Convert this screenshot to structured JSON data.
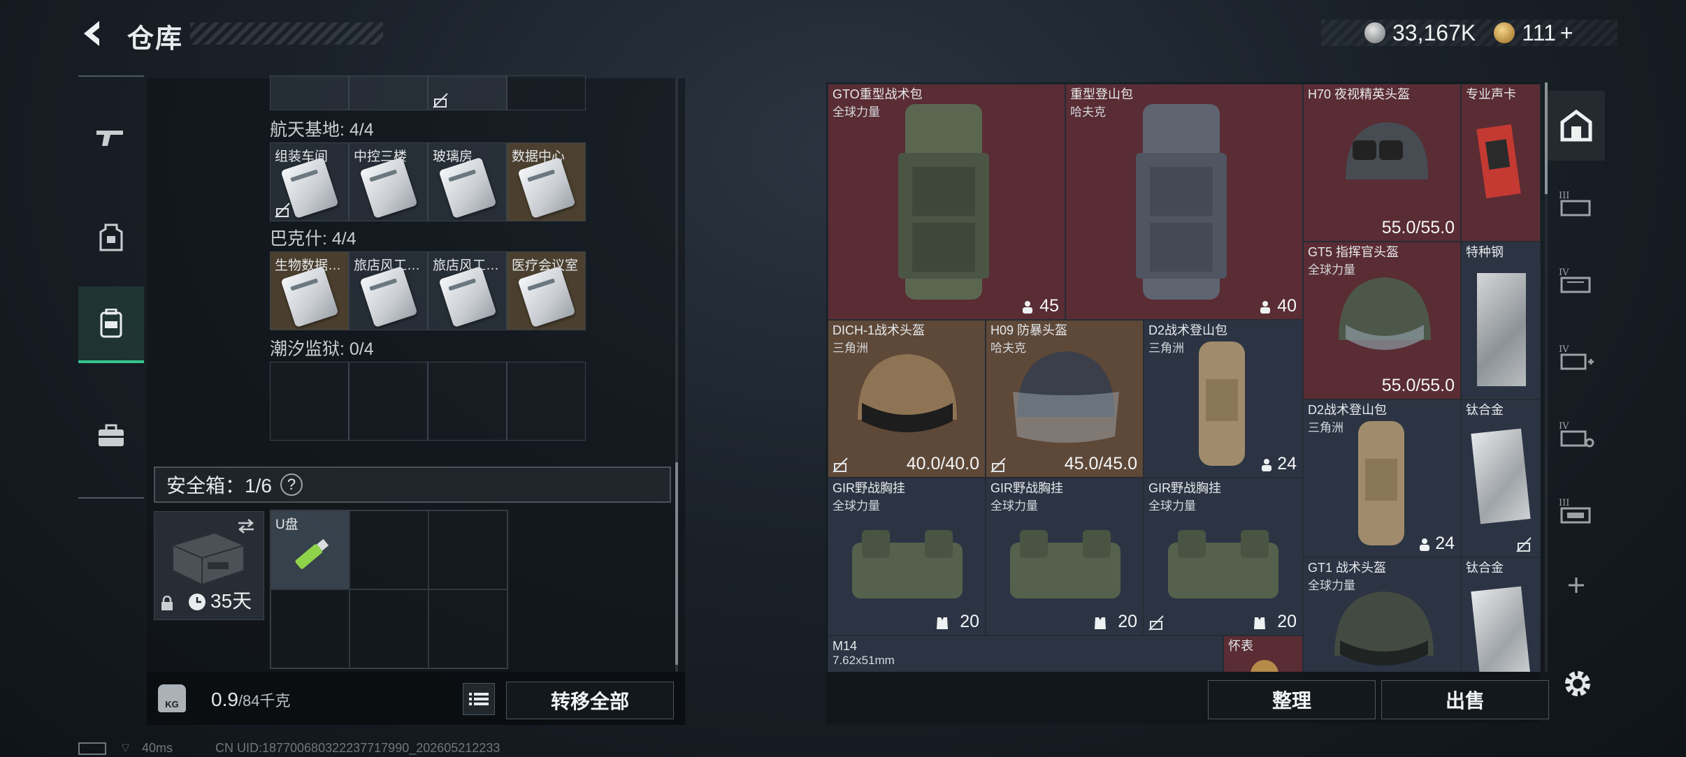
{
  "header": {
    "title": "仓库",
    "currency_silver": "33,167K",
    "currency_gold": "111",
    "currency_gold_add": "+"
  },
  "left_nav": {
    "items": [
      "weapon-icon",
      "armor-icon",
      "backpack-icon",
      "toolbox-icon"
    ],
    "active_index": 2
  },
  "keycards": {
    "sections": [
      {
        "label": "航天基地: 4/4",
        "cards": [
          {
            "name": "组装车间",
            "locked": true
          },
          {
            "name": "中控三楼",
            "locked": false
          },
          {
            "name": "玻璃房",
            "locked": false
          },
          {
            "name": "数据中心",
            "locked": false
          }
        ]
      },
      {
        "label": "巴克什: 4/4",
        "cards": [
          {
            "name": "生物数据…",
            "locked": false
          },
          {
            "name": "旅店风工…",
            "locked": false
          },
          {
            "name": "旅店风工…",
            "locked": false
          },
          {
            "name": "医疗会议室",
            "locked": false
          }
        ]
      },
      {
        "label": "潮汐监狱: 0/4",
        "cards": []
      }
    ]
  },
  "safe": {
    "label": "安全箱：1/6",
    "help": "?",
    "days": "35天",
    "usb_label": "U盘"
  },
  "weight": {
    "value": "0.9",
    "unit": "/84千克",
    "icon_text": "KG"
  },
  "buttons": {
    "transfer_all": "转移全部",
    "organize": "整理",
    "sell": "出售"
  },
  "inventory": [
    {
      "name": "GTO重型战术包",
      "sub": "全球力量",
      "value": "45",
      "color": "red"
    },
    {
      "name": "重型登山包",
      "sub": "哈夫克",
      "value": "40",
      "color": "red"
    },
    {
      "name": "H70 夜视精英头盔",
      "sub": "",
      "value": "55.0/55.0",
      "color": "red"
    },
    {
      "name": "专业声卡",
      "sub": "",
      "value": "",
      "color": "red"
    },
    {
      "name": "GT5 指挥官头盔",
      "sub": "全球力量",
      "value": "55.0/55.0",
      "color": "red"
    },
    {
      "name": "特种钢",
      "sub": "",
      "value": "",
      "color": "blue"
    },
    {
      "name": "DICH-1战术头盔",
      "sub": "三角洲",
      "value": "40.0/40.0",
      "color": "gold"
    },
    {
      "name": "H09 防暴头盔",
      "sub": "哈夫克",
      "value": "45.0/45.0",
      "color": "gold"
    },
    {
      "name": "D2战术登山包",
      "sub": "三角洲",
      "value": "24",
      "color": "blue"
    },
    {
      "name": "D2战术登山包",
      "sub": "三角洲",
      "value": "24",
      "color": "blue"
    },
    {
      "name": "钛合金",
      "sub": "",
      "value": "",
      "color": "blue"
    },
    {
      "name": "GIR野战胸挂",
      "sub": "全球力量",
      "value": "20",
      "color": "blue"
    },
    {
      "name": "GIR野战胸挂",
      "sub": "全球力量",
      "value": "20",
      "color": "blue"
    },
    {
      "name": "GIR野战胸挂",
      "sub": "全球力量",
      "value": "20",
      "color": "blue"
    },
    {
      "name": "GT1 战术头盔",
      "sub": "全球力量",
      "value": "",
      "color": "blue"
    },
    {
      "name": "钛合金",
      "sub": "",
      "value": "",
      "color": "blue"
    },
    {
      "name": "M14",
      "sub": "7.62x51mm",
      "value": "",
      "color": "blue"
    },
    {
      "name": "怀表",
      "sub": "",
      "value": "",
      "color": "red"
    }
  ],
  "right_nav": {
    "items": [
      "home-icon",
      "rack-iii-icon",
      "rack-iv-icon",
      "rack-iv-med-icon",
      "rack-iv-tool-icon",
      "rack-iii-b-icon",
      "add-icon"
    ]
  },
  "status": {
    "ping": "40ms",
    "uid": "CN UID:187700680322237717990_202605212233"
  },
  "colors": {
    "accent_green": "#35c48f",
    "rarity_red": "#5a2c34",
    "rarity_gold": "#5e4838",
    "rarity_blue": "#2c3444"
  }
}
